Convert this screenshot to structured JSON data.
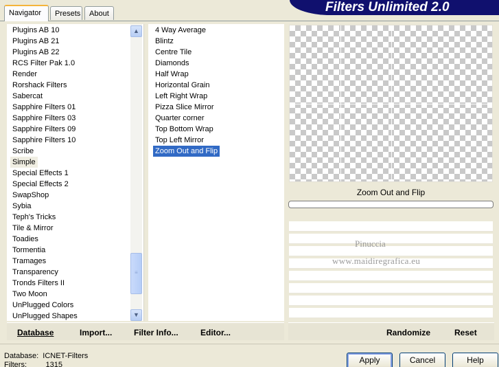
{
  "tabs": [
    {
      "label": "Navigator",
      "active": true
    },
    {
      "label": "Presets",
      "active": false
    },
    {
      "label": "About",
      "active": false
    }
  ],
  "title": "Filters Unlimited 2.0",
  "categories": [
    "Plugins AB 10",
    "Plugins AB 21",
    "Plugins AB 22",
    "RCS Filter Pak 1.0",
    "Render",
    "Rorshack Filters",
    "Sabercat",
    "Sapphire Filters 01",
    "Sapphire Filters 03",
    "Sapphire Filters 09",
    "Sapphire Filters 10",
    "Scribe",
    "Simple",
    "Special Effects 1",
    "Special Effects 2",
    "SwapShop",
    "Sybia",
    "Teph's Tricks",
    "Tile & Mirror",
    "Toadies",
    "Tormentia",
    "Tramages",
    "Transparency",
    "Tronds Filters II",
    "Two Moon",
    "UnPlugged Colors",
    "UnPlugged Shapes"
  ],
  "selected_category": "Simple",
  "filters": [
    "4 Way Average",
    "Blintz",
    "Centre Tile",
    "Diamonds",
    "Half Wrap",
    "Horizontal Grain",
    "Left Right Wrap",
    "Pizza Slice Mirror",
    "Quarter corner",
    "Top Bottom Wrap",
    "Top Left Mirror",
    "Zoom Out and Flip"
  ],
  "selected_filter": "Zoom Out and Flip",
  "preview_title": "Zoom Out and Flip",
  "progress_fraction": 0,
  "watermark": {
    "line1": "Pinuccia",
    "line2": "www.maidiregrafica.eu"
  },
  "toolbar_left": {
    "database": "Database",
    "import": "Import...",
    "filter_info": "Filter Info...",
    "editor": "Editor..."
  },
  "toolbar_right": {
    "randomize": "Randomize",
    "reset": "Reset"
  },
  "status": {
    "database_label": "Database:",
    "database_value": "ICNET-Filters",
    "filters_label": "Filters:",
    "filters_value": "1315"
  },
  "buttons": {
    "apply": "Apply",
    "cancel": "Cancel",
    "help": "Help"
  },
  "icons": {
    "scroll_up": "chevron-up-icon",
    "scroll_down": "chevron-down-icon"
  }
}
